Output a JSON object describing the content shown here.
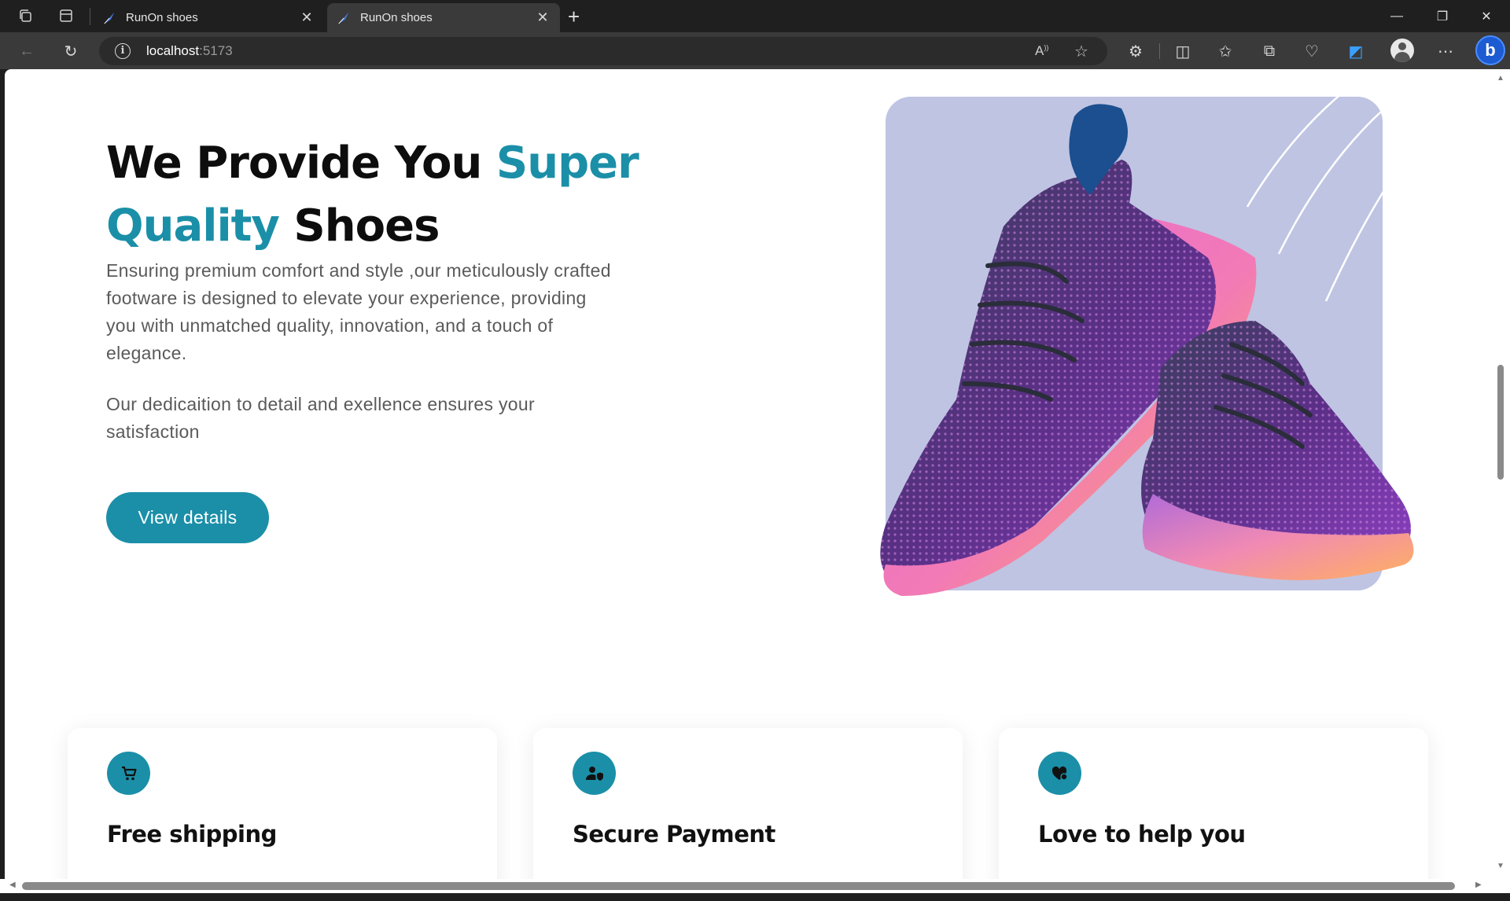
{
  "browser": {
    "tabs": [
      {
        "title": "RunOn shoes",
        "active": false
      },
      {
        "title": "RunOn shoes",
        "active": true
      }
    ],
    "address": {
      "host": "localhost",
      "port": ":5173"
    }
  },
  "hero": {
    "title_part1": "We Provide You ",
    "title_accent1": "Super",
    "title_accent2": "Quality",
    "title_part2": " Shoes",
    "paragraph1": "Ensuring premium comfort and style ,our meticulously crafted footware is designed to elevate your experience, providing you with unmatched quality, innovation, and a touch of elegance.",
    "paragraph2": "Our dedicaition to detail and exellence ensures your satisfaction",
    "cta_label": "View details"
  },
  "features": [
    {
      "title": "Free shipping",
      "icon": "cart-icon"
    },
    {
      "title": "Secure Payment",
      "icon": "user-shield-icon"
    },
    {
      "title": "Love to help you",
      "icon": "heart-hand-icon"
    }
  ],
  "colors": {
    "accent": "#1b8fa8",
    "card_bg": "#bfc4e3",
    "text_dark": "#0d0d0d",
    "text_body": "#5a5a5a"
  }
}
